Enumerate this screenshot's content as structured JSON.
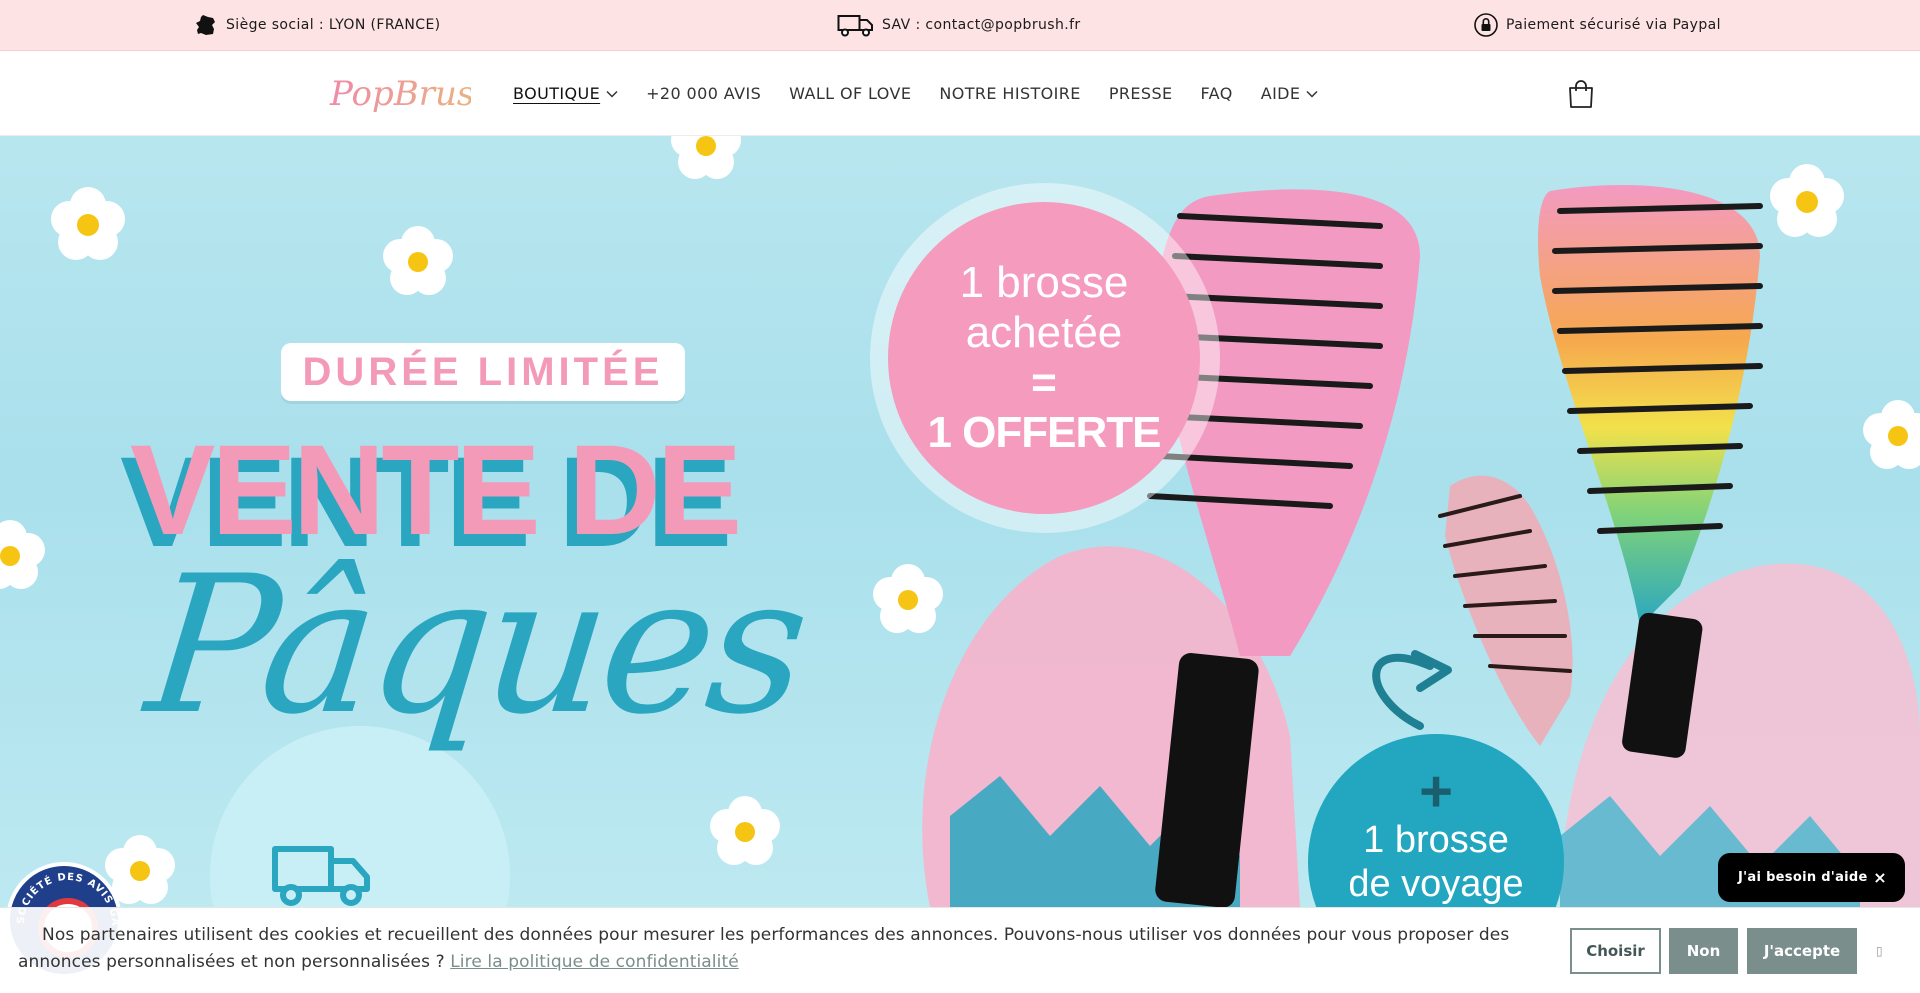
{
  "topbar": {
    "hq_text": "Siège social : LYON (FRANCE)",
    "hq_icon": "france-map-icon",
    "sav_text": "SAV : contact@popbrush.fr",
    "sav_icon": "truck-icon",
    "payment_text": "Paiement sécurisé via Paypal",
    "payment_icon": "lock-icon",
    "background": "#fde3e4"
  },
  "header": {
    "logo_text": "PopBrush",
    "nav": [
      {
        "label": "BOUTIQUE",
        "has_dropdown": true,
        "active": true
      },
      {
        "label": "+20 000 AVIS",
        "has_dropdown": false
      },
      {
        "label": "WALL OF LOVE",
        "has_dropdown": false
      },
      {
        "label": "NOTRE HISTOIRE",
        "has_dropdown": false
      },
      {
        "label": "PRESSE",
        "has_dropdown": false
      },
      {
        "label": "FAQ",
        "has_dropdown": false
      },
      {
        "label": "AIDE",
        "has_dropdown": true
      }
    ],
    "cart_icon": "shopping-bag-icon"
  },
  "hero": {
    "badge_text": "DURÉE LIMITÉE",
    "title_line1": "VENTE DE",
    "title_line2": "Pâques",
    "offer": {
      "line1": "1 brosse",
      "line2": "achetée",
      "line3": "=",
      "line4": "1 OFFERTE"
    },
    "bonus": {
      "plus": "+",
      "line1": "1 brosse",
      "line2": "de voyage"
    },
    "colors": {
      "pink": "#f49ab9",
      "teal": "#2aa6c1",
      "sky": "#b8e6ef"
    }
  },
  "chat_widget": {
    "label": "J'ai besoin d'aide",
    "close": "×"
  },
  "review_badge": {
    "text": "SOCIÉTÉ DES AVIS GARANTIS"
  },
  "cookie_banner": {
    "message": "Nos partenaires utilisent des cookies et recueillent des données pour mesurer les performances des annonces. Pouvons-nous utiliser vos données pour vous proposer des annonces personnalisées et non personnalisées ?",
    "privacy_link": "Lire la politique de confidentialité",
    "choose_label": "Choisir",
    "decline_label": "Non",
    "accept_label": "J'accepte",
    "dismiss": "▯",
    "button_color": "#7a8e8b"
  }
}
